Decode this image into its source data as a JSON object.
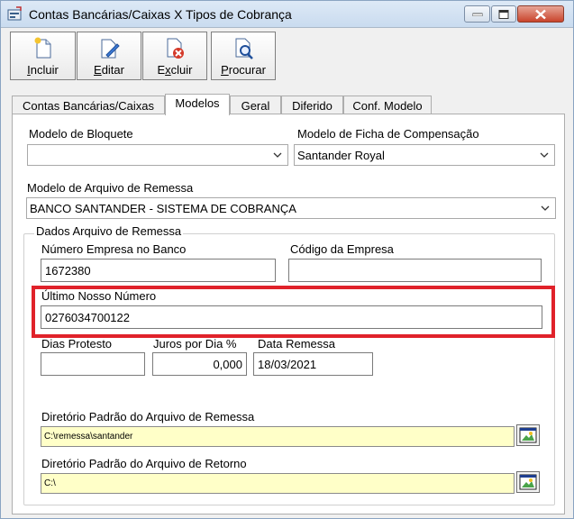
{
  "window": {
    "title": "Contas Bancárias/Caixas X Tipos de Cobrança"
  },
  "toolbar": {
    "include": {
      "mnemonic": "I",
      "rest": "ncluir"
    },
    "edit": {
      "mnemonic": "E",
      "rest": "ditar"
    },
    "delete": {
      "mnemonic": "x",
      "pre": "E",
      "rest": "cluir"
    },
    "search": {
      "mnemonic": "P",
      "rest": "rocurar"
    }
  },
  "tabs": [
    {
      "label": "Contas Bancárias/Caixas"
    },
    {
      "label": "Modelos"
    },
    {
      "label": "Geral"
    },
    {
      "label": "Diferido"
    },
    {
      "label": "Conf. Modelo"
    }
  ],
  "form": {
    "modelo_bloquete": {
      "label": "Modelo de Bloquete",
      "value": ""
    },
    "modelo_ficha": {
      "label": "Modelo de Ficha de Compensação",
      "value": "Santander Royal"
    },
    "modelo_arquivo": {
      "label": "Modelo de Arquivo de Remessa",
      "value": "BANCO SANTANDER - SISTEMA DE COBRANÇA"
    },
    "group_title": "Dados Arquivo de Remessa",
    "numero_empresa": {
      "label": "Número Empresa no Banco",
      "value": "1672380"
    },
    "codigo_empresa": {
      "label": "Código da Empresa",
      "value": ""
    },
    "ultimo_nosso_numero": {
      "label": "Último Nosso Número",
      "value": "0276034700122"
    },
    "dias_protesto": {
      "label": "Dias Protesto",
      "value": ""
    },
    "juros_dia": {
      "label": "Juros por Dia %",
      "value": "0,000"
    },
    "data_remessa": {
      "label": "Data Remessa",
      "value": "18/03/2021"
    },
    "dir_remessa": {
      "label": "Diretório Padrão do Arquivo de Remessa",
      "value": "C:\\remessa\\santander"
    },
    "dir_retorno": {
      "label": "Diretório Padrão do Arquivo de Retorno",
      "value": "C:\\"
    }
  },
  "colors": {
    "highlight": "#e0222a",
    "path_field_bg": "#ffffc8"
  }
}
